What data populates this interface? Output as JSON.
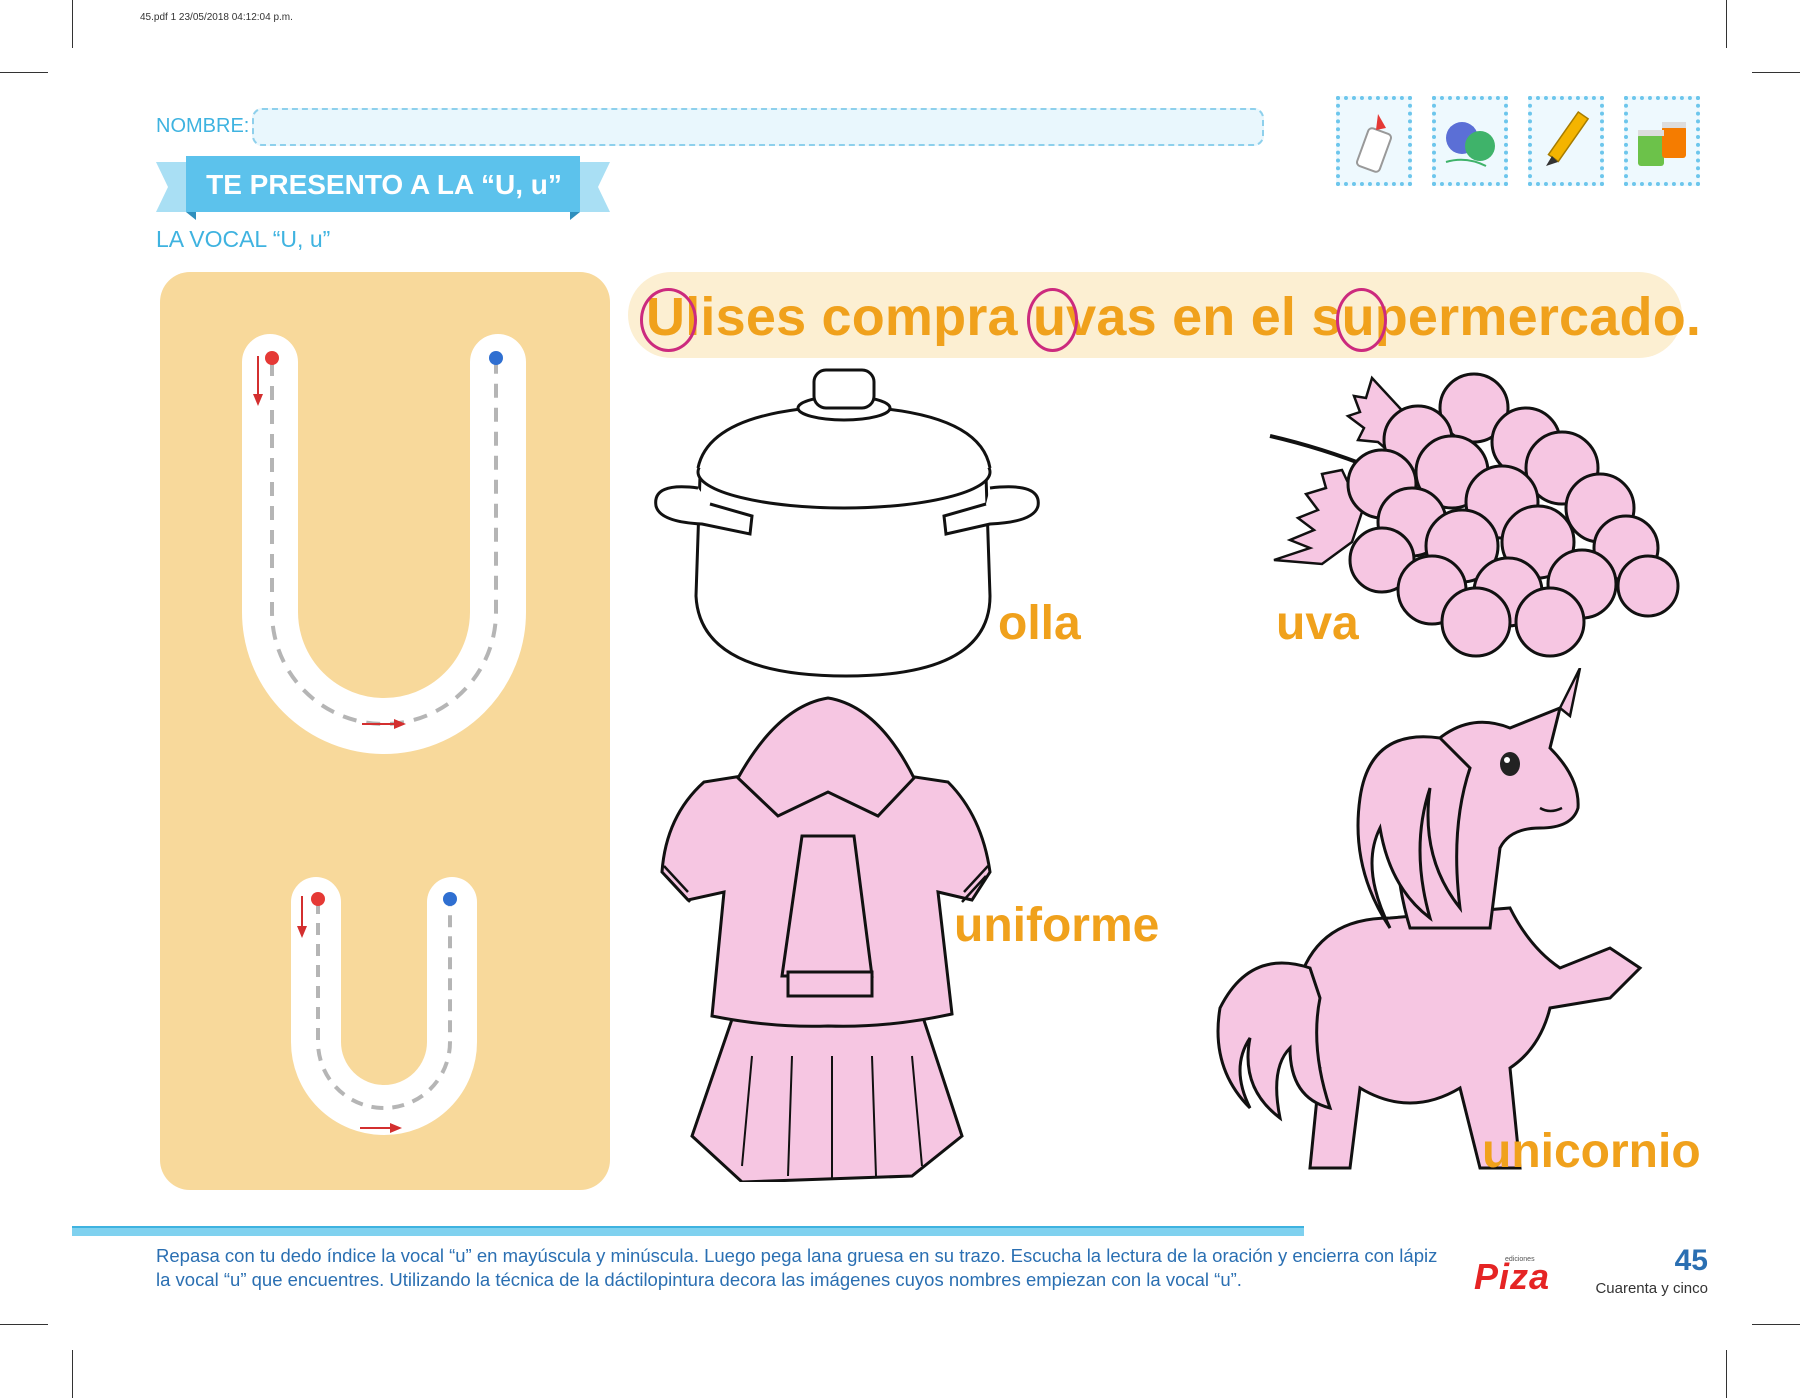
{
  "file_info": "45.pdf   1   23/05/2018   04:12:04 p.m.",
  "header": {
    "name_label": "NOMBRE:",
    "title": "TE PRESENTO A LA “U, u”",
    "subtitle": "LA VOCAL “U, u”"
  },
  "materials": [
    {
      "icon": "glue-icon"
    },
    {
      "icon": "yarn-icon"
    },
    {
      "icon": "pencil-icon"
    },
    {
      "icon": "paint-icon"
    }
  ],
  "sentence": {
    "p1_hl": "U",
    "p2": "lises compra ",
    "p3_hl": "u",
    "p4": "vas en el s",
    "p5_hl": "u",
    "p6": "permercado."
  },
  "pictures": [
    {
      "icon": "pot-icon",
      "word": "olla"
    },
    {
      "icon": "grapes-icon",
      "word": "uva"
    },
    {
      "icon": "uniform-icon",
      "word": "uniforme"
    },
    {
      "icon": "unicorn-icon",
      "word": "unicornio"
    }
  ],
  "footer": {
    "instructions": "Repasa con tu dedo índice la vocal “u” en mayúscula y minúscula. Luego pega lana gruesa en su trazo. Escucha la lectura de la oración y encierra con lápiz la vocal “u” que encuentres. Utilizando la técnica de la dáctilopintura decora las imágenes cuyos nombres empiezan con la vocal “u”.",
    "brand_tag": "ediciones",
    "brand": "Piza",
    "page_number": "45",
    "page_words": "Cuarenta y cinco"
  },
  "colors": {
    "accent_blue": "#3fb3e0",
    "orange_text": "#f0a11c",
    "panel_yellow": "#f8d99b",
    "pink_fill": "#f6c6e2",
    "circle_magenta": "#cc2a7e"
  }
}
